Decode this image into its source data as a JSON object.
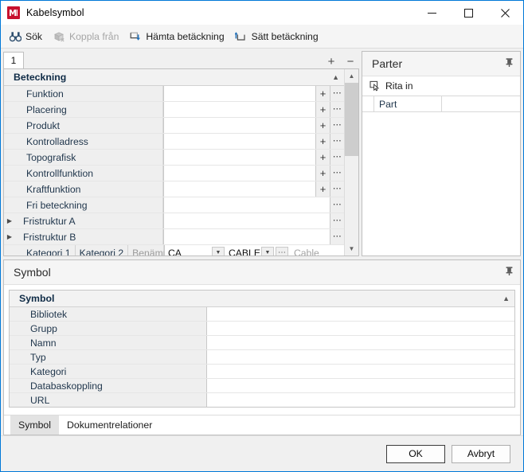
{
  "window": {
    "title": "Kabelsymbol",
    "app_icon": "app-logo-icon",
    "minimize_label": "—",
    "maximize_label": "☐",
    "close_label": "✕"
  },
  "toolbar": {
    "items": [
      {
        "label": "Sök",
        "icon": "binoculars-icon",
        "disabled": false
      },
      {
        "label": "Koppla från",
        "icon": "unlink-box-icon",
        "disabled": true
      },
      {
        "label": "Hämta betäckning",
        "icon": "fetch-down-icon",
        "disabled": false
      },
      {
        "label": "Sätt betäckning",
        "icon": "set-up-icon",
        "disabled": false
      }
    ]
  },
  "designation": {
    "tab_label": "1",
    "add_label": "+",
    "remove_label": "−",
    "group_title": "Beteckning",
    "collapse_icon": "chevron-up-icon",
    "rows": [
      {
        "label": "Funktion",
        "value": "",
        "expander": false,
        "plus": true,
        "dots": true
      },
      {
        "label": "Placering",
        "value": "",
        "expander": false,
        "plus": true,
        "dots": true
      },
      {
        "label": "Produkt",
        "value": "",
        "expander": false,
        "plus": true,
        "dots": true
      },
      {
        "label": "Kontrolladress",
        "value": "",
        "expander": false,
        "plus": true,
        "dots": true
      },
      {
        "label": "Topografisk",
        "value": "",
        "expander": false,
        "plus": true,
        "dots": true
      },
      {
        "label": "Kontrollfunktion",
        "value": "",
        "expander": false,
        "plus": true,
        "dots": true
      },
      {
        "label": "Kraftfunktion",
        "value": "",
        "expander": false,
        "plus": true,
        "dots": true
      },
      {
        "label": "Fri beteckning",
        "value": "",
        "expander": false,
        "plus": false,
        "dots": true
      },
      {
        "label": "Fristruktur A",
        "value": "",
        "expander": true,
        "plus": false,
        "dots": true
      },
      {
        "label": "Fristruktur B",
        "value": "",
        "expander": true,
        "plus": false,
        "dots": true
      }
    ],
    "category_row": {
      "col1_label": "Kategori 1",
      "col2_label": "Kategori 2",
      "col3_label": "Benämning",
      "category1_value": "CA",
      "category2_value": "CABLE",
      "description_placeholder": "Cable",
      "dropdown_icon": "chevron-down-icon",
      "dots_label": "⋯"
    },
    "scrollbar": {
      "up_icon": "scroll-up-icon",
      "down_icon": "scroll-down-icon"
    }
  },
  "parter": {
    "title": "Parter",
    "pin_icon": "pin-icon",
    "draw_label": "Rita in",
    "draw_icon": "draw-cursor-icon",
    "column_header": "Part",
    "rows": []
  },
  "symbol": {
    "title": "Symbol",
    "pin_icon": "pin-icon",
    "group_title": "Symbol",
    "collapse_icon": "chevron-up-icon",
    "rows": [
      {
        "label": "Bibliotek",
        "value": ""
      },
      {
        "label": "Grupp",
        "value": ""
      },
      {
        "label": "Namn",
        "value": ""
      },
      {
        "label": "Typ",
        "value": ""
      },
      {
        "label": "Kategori",
        "value": ""
      },
      {
        "label": "Databaskoppling",
        "value": ""
      },
      {
        "label": "URL",
        "value": ""
      }
    ],
    "tabs": [
      {
        "label": "Symbol",
        "active": true
      },
      {
        "label": "Dokumentrelationer",
        "active": false
      }
    ]
  },
  "footer": {
    "ok_label": "OK",
    "cancel_label": "Avbryt"
  }
}
